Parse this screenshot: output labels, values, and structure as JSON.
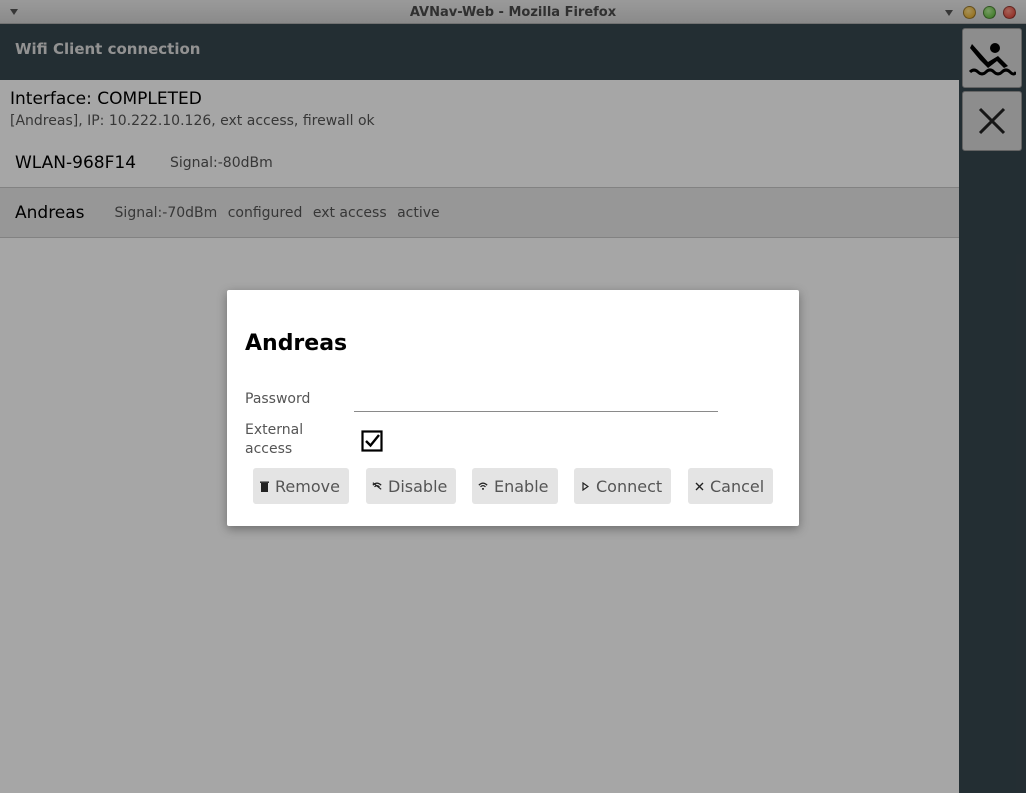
{
  "window": {
    "title": "AVNav-Web - Mozilla Firefox"
  },
  "header": {
    "title": "Wifi Client connection"
  },
  "status": {
    "interface": "Interface: COMPLETED",
    "details": "[Andreas], IP: 10.222.10.126, ext access, firewall ok"
  },
  "networks": [
    {
      "ssid": "WLAN-968F14",
      "signal": "Signal:-80dBm",
      "tags": []
    },
    {
      "ssid": "Andreas",
      "signal": "Signal:-70dBm",
      "tags": [
        "configured",
        "ext access",
        "active"
      ]
    }
  ],
  "rightbar": {
    "icons": [
      "anchor-watch-icon",
      "close-icon"
    ]
  },
  "dialog": {
    "title": "Andreas",
    "password_label": "Password",
    "password_value": "",
    "external_access_label": "External access",
    "external_access_checked": true,
    "buttons": {
      "remove": "Remove",
      "disable": "Disable",
      "enable": "Enable",
      "connect": "Connect",
      "cancel": "Cancel"
    }
  }
}
